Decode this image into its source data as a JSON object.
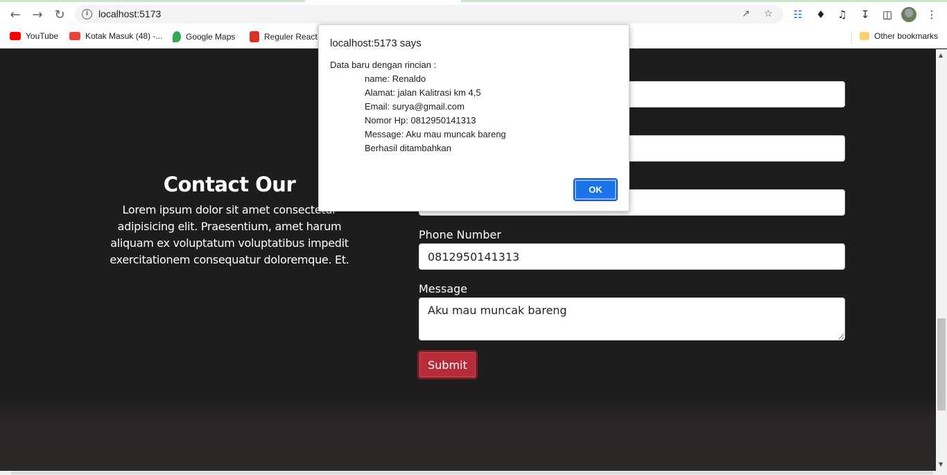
{
  "browser": {
    "url": "localhost:5173",
    "bookmarks": [
      {
        "label": "YouTube",
        "color": "#ff0000"
      },
      {
        "label": "Kotak Masuk (48) -...",
        "color": "#ea4335"
      },
      {
        "label": "Google Maps",
        "color": "#34a853"
      },
      {
        "label": "Reguler React",
        "color": "#d93025"
      }
    ],
    "other_bookmarks": "Other bookmarks"
  },
  "page": {
    "heading": "Contact Our",
    "description": "Lorem ipsum dolor sit amet consectetur adipisicing elit. Praesentium, amet harum aliquam ex voluptatum voluptatibus impedit exercitationem consequatur doloremque. Et.",
    "form": {
      "phone_label": "Phone Number",
      "phone_value": "0812950141313",
      "message_label": "Message",
      "message_value": "Aku mau muncak bareng",
      "submit_label": "Submit"
    },
    "colors": {
      "background": "#1e1d1d",
      "submit": "#b82c3a"
    }
  },
  "dialog": {
    "origin": "localhost:5173 says",
    "lines": [
      "Data baru dengan rincian :",
      "name: Renaldo",
      "Alamat: jalan Kalitrasi km 4,5",
      "Email: surya@gmail.com",
      "Nomor Hp: 0812950141313",
      "Message: Aku mau muncak bareng",
      "Berhasil ditambahkan"
    ],
    "ok_label": "OK"
  }
}
